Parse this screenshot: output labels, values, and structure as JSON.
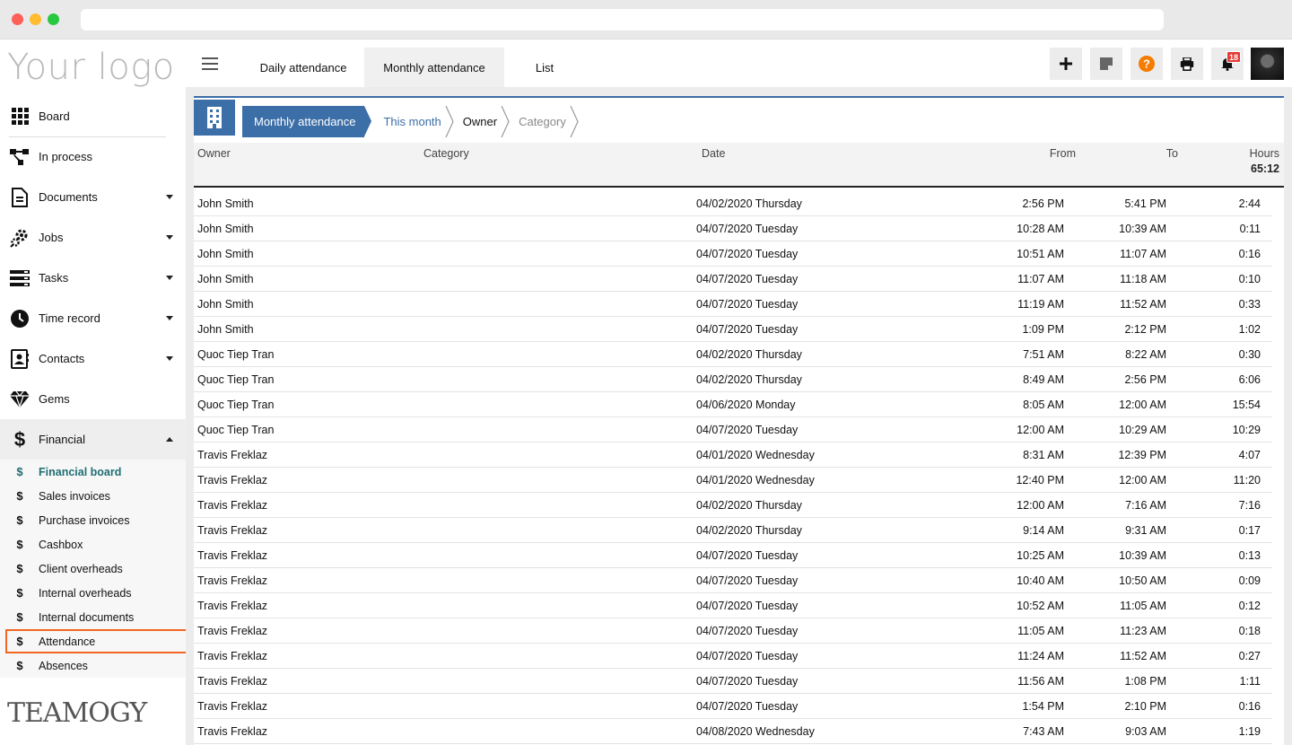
{
  "sidebar": {
    "logo": "Your logo",
    "items": [
      {
        "label": "Board",
        "icon": "grid-icon",
        "caret": false
      },
      {
        "label": "In process",
        "icon": "flow-icon",
        "caret": false
      },
      {
        "label": "Documents",
        "icon": "document-icon",
        "caret": true
      },
      {
        "label": "Jobs",
        "icon": "gears-icon",
        "caret": true
      },
      {
        "label": "Tasks",
        "icon": "tasks-icon",
        "caret": true
      },
      {
        "label": "Time record",
        "icon": "clock-icon",
        "caret": true
      },
      {
        "label": "Contacts",
        "icon": "contact-card-icon",
        "caret": true
      },
      {
        "label": "Gems",
        "icon": "gem-icon",
        "caret": false
      }
    ],
    "financial": {
      "label": "Financial",
      "icon": "dollar-icon",
      "subitems": [
        "Financial board",
        "Sales invoices",
        "Purchase invoices",
        "Cashbox",
        "Client overheads",
        "Internal overheads",
        "Internal documents",
        "Attendance",
        "Absences"
      ],
      "current": "Financial board",
      "highlight": "Attendance"
    },
    "brand": "TEAMOGY"
  },
  "topbar": {
    "tabs": [
      "Daily attendance",
      "Monthly attendance",
      "List"
    ],
    "active_tab": "Monthly attendance",
    "notifications": "18",
    "accent": "#f57c00"
  },
  "breadcrumb": {
    "items": [
      "Monthly attendance",
      "This month",
      "Owner",
      "Category"
    ]
  },
  "table": {
    "headers": {
      "owner": "Owner",
      "category": "Category",
      "date": "Date",
      "from": "From",
      "to": "To",
      "hours": "Hours"
    },
    "total_hours": "65:12",
    "rows": [
      {
        "owner": "John Smith",
        "date": "04/02/2020 Thursday",
        "from": "2:56 PM",
        "to": "5:41 PM",
        "hours": "2:44"
      },
      {
        "owner": "John Smith",
        "date": "04/07/2020 Tuesday",
        "from": "10:28 AM",
        "to": "10:39 AM",
        "hours": "0:11"
      },
      {
        "owner": "John Smith",
        "date": "04/07/2020 Tuesday",
        "from": "10:51 AM",
        "to": "11:07 AM",
        "hours": "0:16"
      },
      {
        "owner": "John Smith",
        "date": "04/07/2020 Tuesday",
        "from": "11:07 AM",
        "to": "11:18 AM",
        "hours": "0:10"
      },
      {
        "owner": "John Smith",
        "date": "04/07/2020 Tuesday",
        "from": "11:19 AM",
        "to": "11:52 AM",
        "hours": "0:33"
      },
      {
        "owner": "John Smith",
        "date": "04/07/2020 Tuesday",
        "from": "1:09 PM",
        "to": "2:12 PM",
        "hours": "1:02"
      },
      {
        "owner": "Quoc Tiep Tran",
        "date": "04/02/2020 Thursday",
        "from": "7:51 AM",
        "to": "8:22 AM",
        "hours": "0:30"
      },
      {
        "owner": "Quoc Tiep Tran",
        "date": "04/02/2020 Thursday",
        "from": "8:49 AM",
        "to": "2:56 PM",
        "hours": "6:06"
      },
      {
        "owner": "Quoc Tiep Tran",
        "date": "04/06/2020 Monday",
        "from": "8:05 AM",
        "to": "12:00 AM",
        "hours": "15:54"
      },
      {
        "owner": "Quoc Tiep Tran",
        "date": "04/07/2020 Tuesday",
        "from": "12:00 AM",
        "to": "10:29 AM",
        "hours": "10:29"
      },
      {
        "owner": "Travis Freklaz",
        "date": "04/01/2020 Wednesday",
        "from": "8:31 AM",
        "to": "12:39 PM",
        "hours": "4:07"
      },
      {
        "owner": "Travis Freklaz",
        "date": "04/01/2020 Wednesday",
        "from": "12:40 PM",
        "to": "12:00 AM",
        "hours": "11:20"
      },
      {
        "owner": "Travis Freklaz",
        "date": "04/02/2020 Thursday",
        "from": "12:00 AM",
        "to": "7:16 AM",
        "hours": "7:16"
      },
      {
        "owner": "Travis Freklaz",
        "date": "04/02/2020 Thursday",
        "from": "9:14 AM",
        "to": "9:31 AM",
        "hours": "0:17"
      },
      {
        "owner": "Travis Freklaz",
        "date": "04/07/2020 Tuesday",
        "from": "10:25 AM",
        "to": "10:39 AM",
        "hours": "0:13"
      },
      {
        "owner": "Travis Freklaz",
        "date": "04/07/2020 Tuesday",
        "from": "10:40 AM",
        "to": "10:50 AM",
        "hours": "0:09"
      },
      {
        "owner": "Travis Freklaz",
        "date": "04/07/2020 Tuesday",
        "from": "10:52 AM",
        "to": "11:05 AM",
        "hours": "0:12"
      },
      {
        "owner": "Travis Freklaz",
        "date": "04/07/2020 Tuesday",
        "from": "11:05 AM",
        "to": "11:23 AM",
        "hours": "0:18"
      },
      {
        "owner": "Travis Freklaz",
        "date": "04/07/2020 Tuesday",
        "from": "11:24 AM",
        "to": "11:52 AM",
        "hours": "0:27"
      },
      {
        "owner": "Travis Freklaz",
        "date": "04/07/2020 Tuesday",
        "from": "11:56 AM",
        "to": "1:08 PM",
        "hours": "1:11"
      },
      {
        "owner": "Travis Freklaz",
        "date": "04/07/2020 Tuesday",
        "from": "1:54 PM",
        "to": "2:10 PM",
        "hours": "0:16"
      },
      {
        "owner": "Travis Freklaz",
        "date": "04/08/2020 Wednesday",
        "from": "7:43 AM",
        "to": "9:03 AM",
        "hours": "1:19"
      }
    ]
  }
}
